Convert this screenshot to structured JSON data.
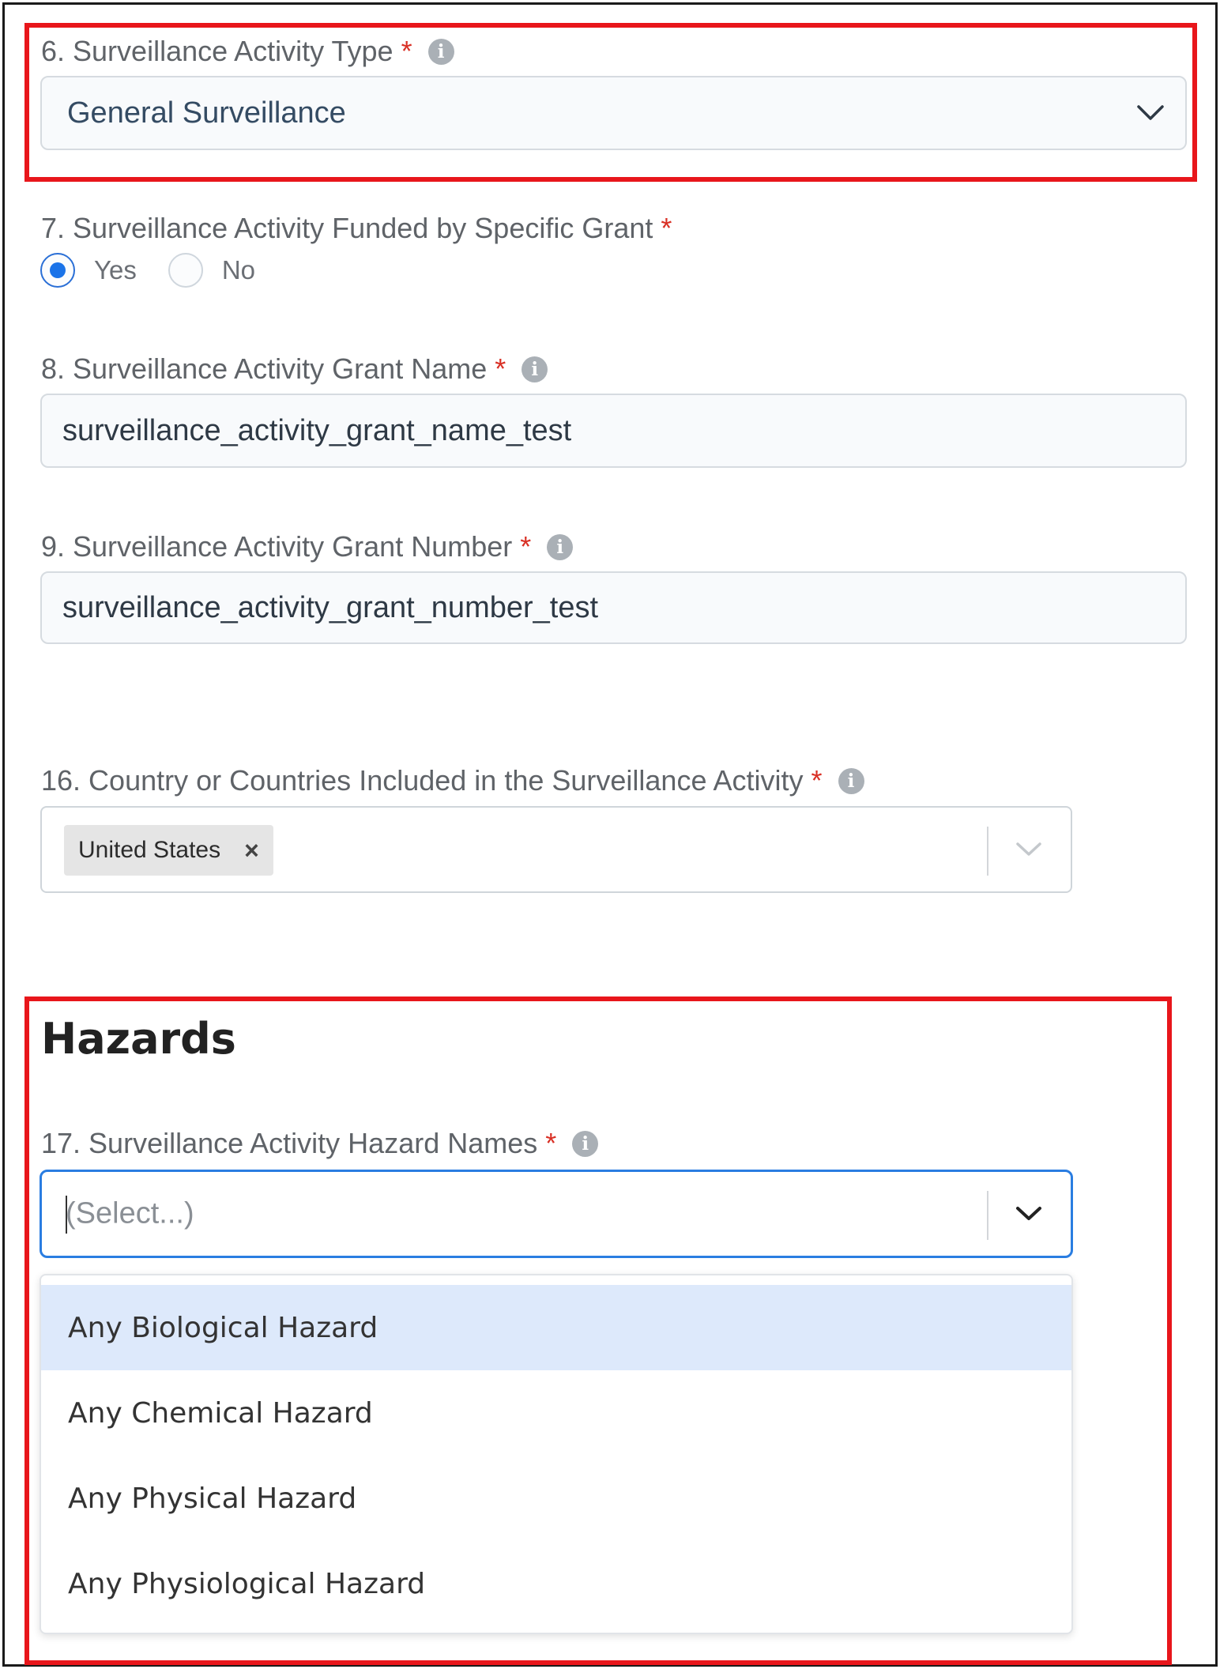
{
  "q6": {
    "label": "6. Surveillance Activity Type",
    "required_mark": "*",
    "selected": "General Surveillance"
  },
  "q7": {
    "label": "7. Surveillance Activity Funded by Specific Grant",
    "required_mark": "*",
    "options": [
      {
        "label": "Yes",
        "checked": true
      },
      {
        "label": "No",
        "checked": false
      }
    ]
  },
  "q8": {
    "label": "8. Surveillance Activity Grant Name",
    "required_mark": "*",
    "value": "surveillance_activity_grant_name_test"
  },
  "q9": {
    "label": "9. Surveillance Activity Grant Number",
    "required_mark": "*",
    "value": "surveillance_activity_grant_number_test"
  },
  "q16": {
    "label": "16. Country or Countries Included in the Surveillance Activity",
    "required_mark": "*",
    "chips": [
      "United States"
    ],
    "chip_remove": "×"
  },
  "hazards": {
    "heading": "Hazards",
    "q17": {
      "label": "17. Surveillance Activity Hazard Names",
      "required_mark": "*",
      "placeholder": "(Select...)",
      "options": [
        "Any Biological Hazard",
        "Any Chemical Hazard",
        "Any Physical Hazard",
        "Any Physiological Hazard"
      ],
      "highlighted_option": "Any Biological Hazard"
    }
  },
  "colors": {
    "highlight": "#e8161b",
    "required": "#d93025",
    "focus": "#2a7de1",
    "option_hover": "#dde9fb",
    "radio_checked": "#1a73e8"
  },
  "icons": {
    "info": "info-icon",
    "chevron": "chevron-down-icon",
    "remove": "close-icon"
  }
}
